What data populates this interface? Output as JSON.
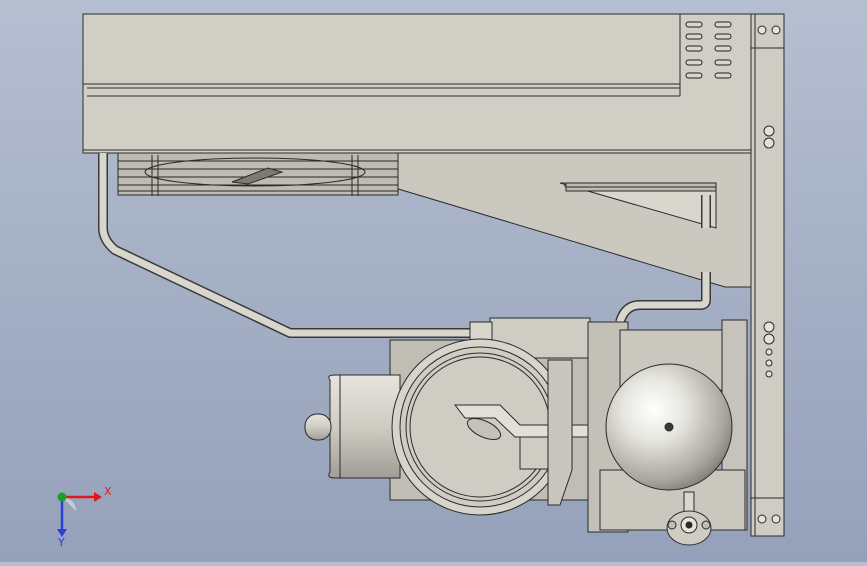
{
  "triad": {
    "x_label": "X",
    "y_label": "Y",
    "colors": {
      "x": "#e01818",
      "y": "#1c9e2a",
      "z": "#2a3fd4"
    }
  },
  "icons": [
    "coordinate-triad-icon"
  ],
  "colors": {
    "background_top": "#b6bfd1",
    "background_bottom": "#95a1ba",
    "part_fill": "#cfcdc3",
    "part_shade": "#a9a79e",
    "edge": "#2a2a2a"
  }
}
